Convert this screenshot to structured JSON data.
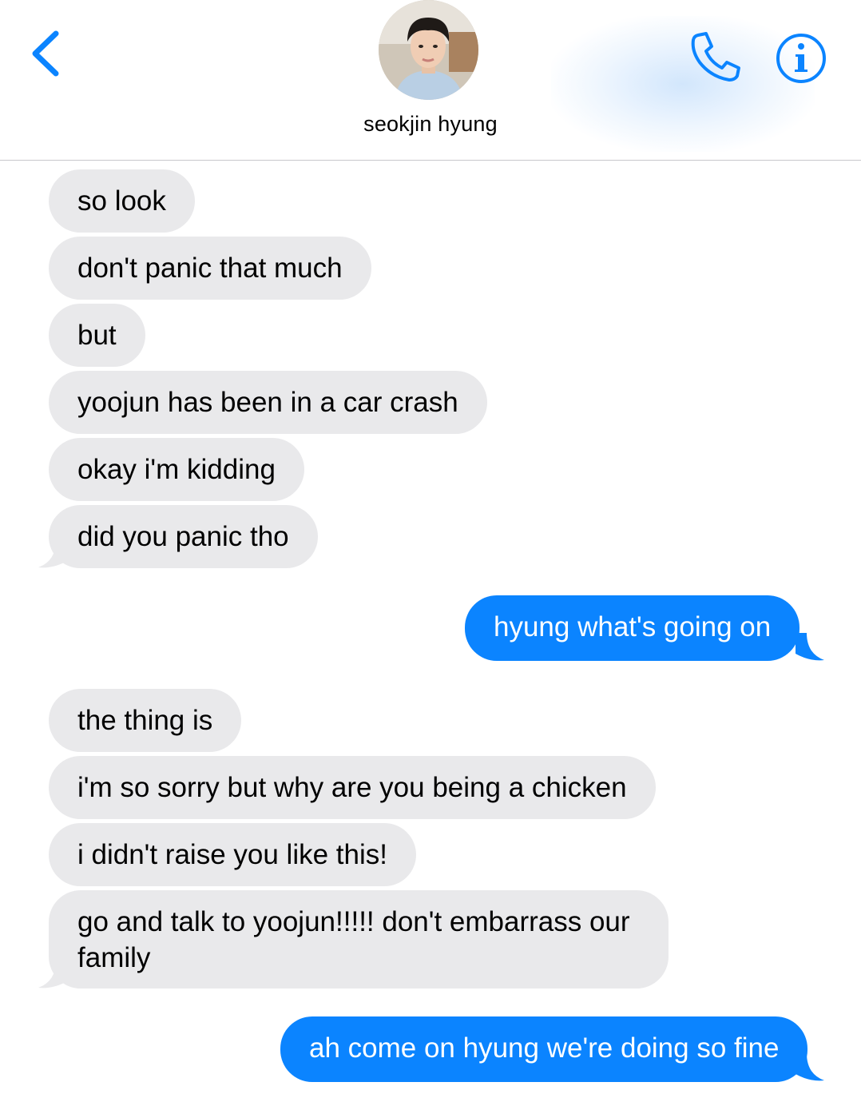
{
  "header": {
    "contact_name": "seokjin hyung",
    "back_icon": "chevron-left-icon",
    "call_icon": "phone-icon",
    "info_icon": "info-icon",
    "accent_color": "#0b84ff"
  },
  "messages": [
    {
      "from": "contact",
      "text": "so look"
    },
    {
      "from": "contact",
      "text": "don't panic that much"
    },
    {
      "from": "contact",
      "text": "but"
    },
    {
      "from": "contact",
      "text": "yoojun has been in a car crash"
    },
    {
      "from": "contact",
      "text": "okay i'm kidding"
    },
    {
      "from": "contact",
      "text": "did you panic tho"
    },
    {
      "from": "me",
      "text": "hyung what's going on"
    },
    {
      "from": "contact",
      "text": "the thing is"
    },
    {
      "from": "contact",
      "text": "i'm so sorry but why are you being a chicken"
    },
    {
      "from": "contact",
      "text": "i didn't raise you like this!"
    },
    {
      "from": "contact",
      "text": "go and talk to yoojun!!!!! don't embarrass our family"
    },
    {
      "from": "me",
      "text": "ah come on hyung we're doing so fine"
    }
  ]
}
